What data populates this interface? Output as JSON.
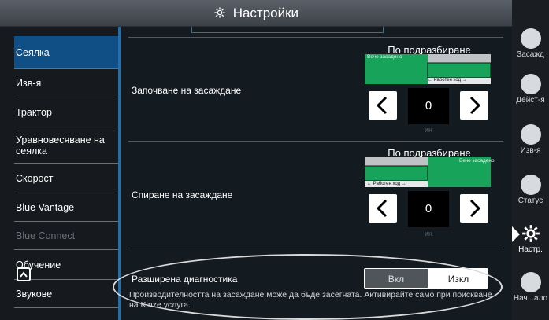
{
  "title": "Настройки",
  "sidebar": {
    "items": [
      {
        "label": "Сеялка",
        "active": true
      },
      {
        "label": "Изв-я"
      },
      {
        "label": "Трактор"
      },
      {
        "label": "Уравновесяване на сеялка"
      },
      {
        "label": "Скорост"
      },
      {
        "label": "Blue Vantage"
      },
      {
        "label": "Blue Connect",
        "disabled": true
      },
      {
        "label": "Обучение"
      },
      {
        "label": "Звукове"
      }
    ]
  },
  "planting_start": {
    "label": "Започване на засаждане",
    "default_label": "По подразбиране",
    "already_planted": "Вече засадено",
    "working_pass": "← Работен ход →",
    "value": "0",
    "unit": "ин"
  },
  "planting_stop": {
    "label": "Спиране на засаждане",
    "default_label": "По подразбиране",
    "already_planted": "Вече засадено",
    "working_pass": "← Работен ход →",
    "value": "0",
    "unit": "ин"
  },
  "advanced_diagnostics": {
    "label": "Разширена диагностика",
    "on_label": "Вкл",
    "off_label": "Изкл",
    "selected": "off",
    "description": "Производителността на засаждане може да бъде засегната. Активирайте само при поискване на Kinze услуга."
  },
  "rightnav": {
    "items": [
      {
        "label": "Засажд",
        "icon": "seed-icon"
      },
      {
        "label": "Дейст-я",
        "icon": "actions-icon"
      },
      {
        "label": "Изв-я",
        "icon": "alert-icon"
      },
      {
        "label": "Статус",
        "icon": "status-icon"
      },
      {
        "label": "Настр.",
        "icon": "gear-icon",
        "active": true
      },
      {
        "label": "Нач...ало",
        "icon": "home-icon"
      }
    ]
  },
  "colors": {
    "accent_blue": "#0f4f86",
    "green": "#18a35a",
    "sidebar_bg": "#16191d",
    "main_bg": "#141b20"
  }
}
